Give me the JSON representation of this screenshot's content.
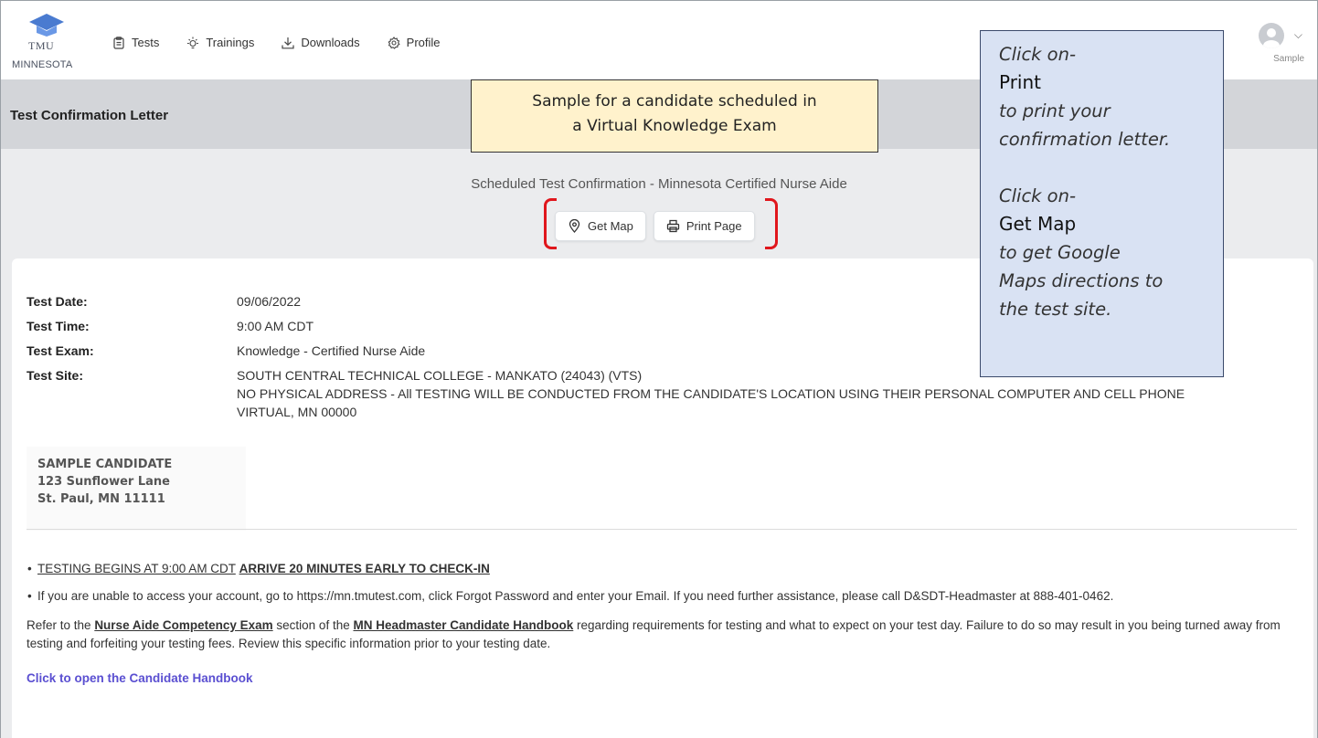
{
  "nav": {
    "logo_tmu": "TMU",
    "logo_state": "MINNESOTA",
    "items": [
      {
        "label": "Tests",
        "icon": "clipboard-icon"
      },
      {
        "label": "Trainings",
        "icon": "lightbulb-icon"
      },
      {
        "label": "Downloads",
        "icon": "download-icon"
      },
      {
        "label": "Profile",
        "icon": "gear-icon"
      }
    ],
    "username": "Sample"
  },
  "pagebar": {
    "title": "Test Confirmation Letter"
  },
  "confirmation": {
    "title": "Scheduled Test Confirmation - Minnesota Certified Nurse Aide",
    "get_map_label": "Get Map",
    "print_label": "Print Page"
  },
  "details": {
    "date_label": "Test Date:",
    "date_value": "09/06/2022",
    "time_label": "Test Time:",
    "time_value": "9:00 AM CDT",
    "exam_label": "Test Exam:",
    "exam_value": "Knowledge - Certified Nurse Aide",
    "site_label": "Test Site:",
    "site_line1": "SOUTH CENTRAL TECHNICAL COLLEGE - MANKATO (24043) (VTS)",
    "site_line2": "NO PHYSICAL ADDRESS - All TESTING WILL BE CONDUCTED FROM THE CANDIDATE'S LOCATION USING THEIR PERSONAL COMPUTER AND CELL PHONE",
    "site_line3": "VIRTUAL, MN 00000"
  },
  "candidate": {
    "name": "SAMPLE CANDIDATE",
    "street": "123 Sunflower Lane",
    "city": "St. Paul, MN 11111"
  },
  "notes": {
    "bullet1_part1": "TESTING BEGINS AT 9:00 AM CDT",
    "bullet1_part2": "ARRIVE 20 MINUTES EARLY TO CHECK-IN",
    "bullet2": "If you are unable to access your account, go to https://mn.tmutest.com, click Forgot Password and enter your Email. If you need further assistance, please call D&SDT-Headmaster at 888-401-0462.",
    "refer_pre": "Refer to the",
    "refer_link1": "Nurse Aide Competency Exam",
    "refer_mid": "section of the",
    "refer_link2": "MN Headmaster Candidate Handbook",
    "refer_post": "regarding requirements for testing and what to expect on your test day. Failure to do so may result in you being turned away from testing and forfeiting your testing fees. Review this specific information prior to your testing date.",
    "handbook_link": "Click to open the Candidate Handbook"
  },
  "annotations": {
    "yellow_line1": "Sample for a candidate scheduled in",
    "yellow_line2": "a Virtual Knowledge Exam",
    "blue_click1": "Click on-",
    "blue_print": "Print",
    "blue_print_desc1": "to print your",
    "blue_print_desc2": "confirmation letter.",
    "blue_click2": "Click on-",
    "blue_map": "Get Map",
    "blue_map_desc1": "to get Google",
    "blue_map_desc2": "Maps directions to",
    "blue_map_desc3": "the test site."
  },
  "colors": {
    "accent_link": "#5a4fd1",
    "highlight_red": "#e0161c",
    "callout_yellow": "#fff2cc",
    "callout_blue": "#d9e2f3",
    "header_gray": "#d3d5d9"
  }
}
